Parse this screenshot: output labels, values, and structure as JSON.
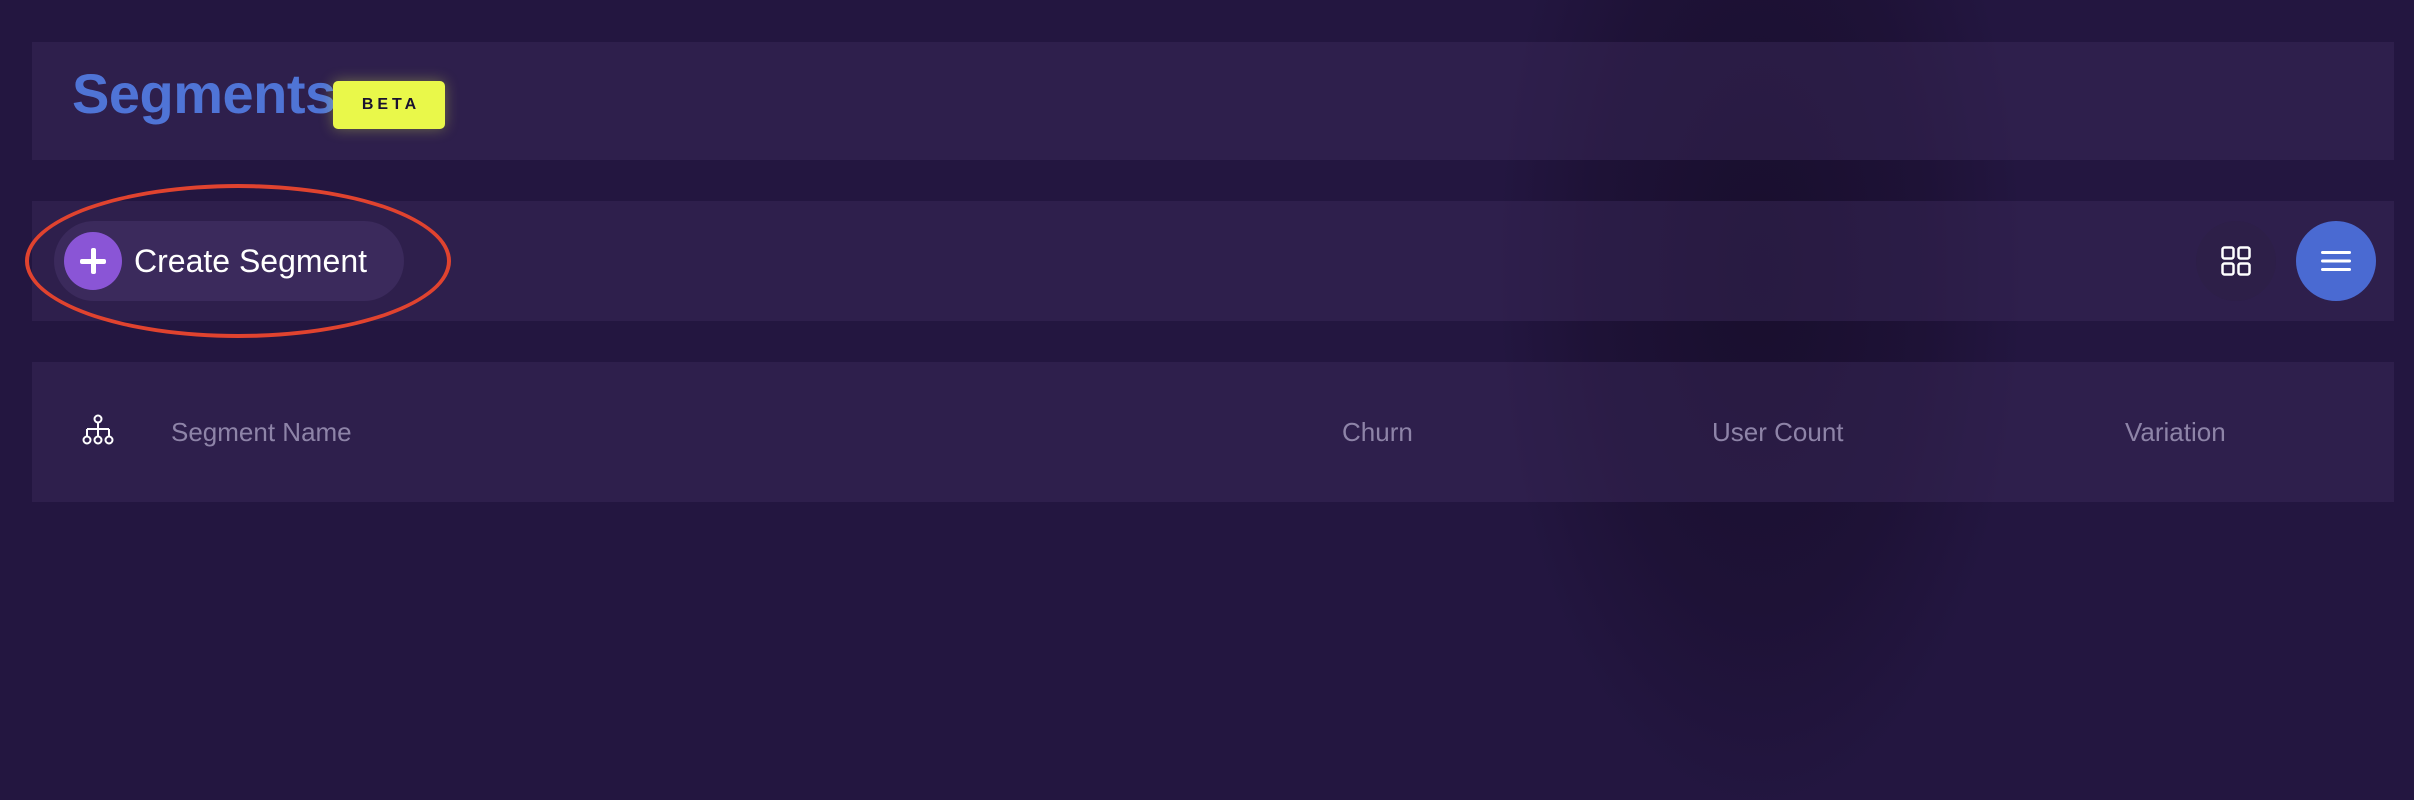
{
  "header": {
    "title": "Segments",
    "badge": "BETA"
  },
  "toolbar": {
    "create_label": "Create Segment",
    "create_icon": "plus-icon",
    "grid_view_icon": "grid-icon",
    "list_view_icon": "list-icon",
    "active_view": "list"
  },
  "table": {
    "header_icon": "hierarchy-icon",
    "columns": [
      "Segment Name",
      "Churn",
      "User Count",
      "Variation"
    ]
  },
  "colors": {
    "background": "#231640",
    "title": "#4f74d6",
    "badge": "#e9f84a",
    "create_icon": "#8a55d6",
    "active_view": "#4a6ad2",
    "highlight": "#e0432f"
  }
}
